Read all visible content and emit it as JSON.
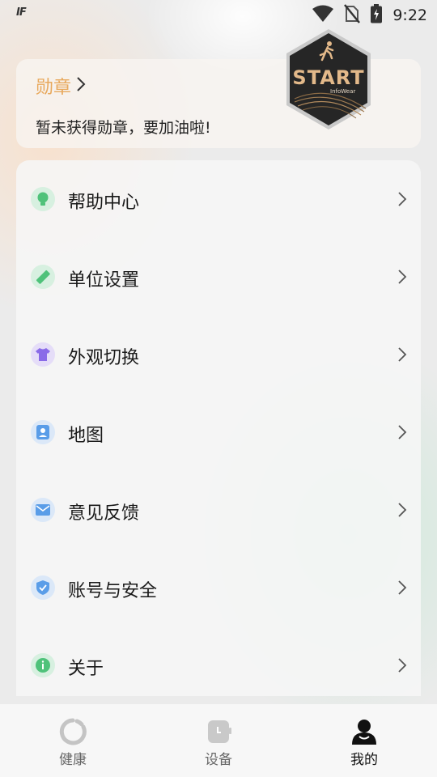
{
  "status_bar": {
    "app_indicator": "IF",
    "time": "9:22",
    "icons": [
      "wifi-icon",
      "no-sim-icon",
      "battery-charging-icon"
    ]
  },
  "medals": {
    "title": "勋章",
    "subtitle": "暂未获得勋章，要加油啦!",
    "badge_text": "START",
    "badge_brand": "InfoWear"
  },
  "menu": {
    "items": [
      {
        "label": "帮助中心",
        "icon": "lightbulb-icon",
        "color": "#4fc27a",
        "bg": "#d7f0e0"
      },
      {
        "label": "单位设置",
        "icon": "ruler-icon",
        "color": "#4fc27a",
        "bg": "#d7f0e0"
      },
      {
        "label": "外观切换",
        "icon": "tshirt-icon",
        "color": "#8a6be8",
        "bg": "#e5ddf8"
      },
      {
        "label": "地图",
        "icon": "map-pin-icon",
        "color": "#5a9de8",
        "bg": "#dbe8f8"
      },
      {
        "label": "意见反馈",
        "icon": "mail-icon",
        "color": "#5a9de8",
        "bg": "#dbe8f8"
      },
      {
        "label": "账号与安全",
        "icon": "shield-check-icon",
        "color": "#5a9de8",
        "bg": "#dbe8f8"
      },
      {
        "label": "关于",
        "icon": "info-icon",
        "color": "#4fc27a",
        "bg": "#d7f0e0"
      }
    ]
  },
  "bottom_nav": {
    "tabs": [
      {
        "label": "健康",
        "icon": "health-ring-icon",
        "active": false
      },
      {
        "label": "设备",
        "icon": "watch-device-icon",
        "active": false
      },
      {
        "label": "我的",
        "icon": "profile-icon",
        "active": true
      }
    ]
  },
  "colors": {
    "accent_medal": "#e8a95d",
    "badge_dark": "#2a2a2a",
    "badge_gold": "#e3b98a"
  }
}
